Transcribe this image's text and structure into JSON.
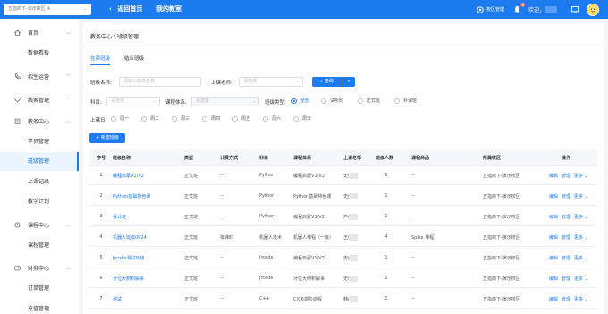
{
  "topbar": {
    "school_select": "五指商下-演示校区 ※",
    "back_label": "返回首页",
    "my_teaching_label": "我的教室",
    "school_manage_label": "校区管理",
    "notify_count": "9",
    "welcome_label": "欢迎，"
  },
  "sidebar": {
    "groups": [
      {
        "label": "首页",
        "icon": "home-icon"
      },
      {
        "label": "招生运营",
        "icon": "phone-icon"
      },
      {
        "label": "线索管理",
        "icon": "heart-icon"
      },
      {
        "label": "教务中心",
        "icon": "building-icon"
      },
      {
        "label": "课程中心",
        "icon": "clock-icon"
      },
      {
        "label": "财务中心",
        "icon": "wallet-icon"
      }
    ],
    "items": {
      "dashboard": "数据看板",
      "students": "学员管理",
      "classes": "班级管理",
      "attendance": "上课记录",
      "plan": "教学计划",
      "courses": "课程管理",
      "orders": "订单管理",
      "recharge": "充值管理"
    }
  },
  "content": {
    "breadcrumb": "教务中心 / 班级管理",
    "tabs": [
      "在读班级",
      "结业班级"
    ],
    "filters": {
      "class_name_label": "班级名称:",
      "class_name_placeholder": "请输入班级名称",
      "teacher_label": "上课老师:",
      "teacher_placeholder": "请选择",
      "query_label": "查询",
      "subject_label": "科目:",
      "subject_placeholder": "请选择",
      "system_label": "课程体系:",
      "system_placeholder": "请选择",
      "class_type_label": "班级类型:",
      "class_type_options": [
        "全部",
        "试听班",
        "正式班",
        "补课班"
      ],
      "weekday_label": "上课日:",
      "weekdays": [
        "周一",
        "周二",
        "周三",
        "周四",
        "周五",
        "周六",
        "周日"
      ]
    },
    "add_label": "+ 新建班级"
  },
  "table": {
    "headers": [
      "序号",
      "班级名称",
      "类型",
      "计费方式",
      "科目",
      "课程体系",
      "上课老师",
      "班级人数",
      "课程商品",
      "所属校区",
      "操作"
    ],
    "rows": [
      {
        "no": "1",
        "name": "编程启蒙V1/V2",
        "type": "正式班",
        "billing": "--",
        "subject": "Python",
        "system": "编程启蒙V1/V2",
        "teacher": "史(",
        "count": "1",
        "product": "--",
        "campus": "五指商下-演示校区"
      },
      {
        "no": "2",
        "name": "Python基础特色课",
        "type": "正式班",
        "billing": "--",
        "subject": "Python",
        "system": "Python基础特色课",
        "teacher": "史(",
        "count": "1",
        "product": "--",
        "campus": "五指商下-演示校区"
      },
      {
        "no": "3",
        "name": "设计班",
        "type": "正式班",
        "billing": "--",
        "subject": "Python",
        "system": "编程启蒙V1/V2",
        "teacher": "芦(",
        "count": "1",
        "product": "--",
        "campus": "五指商下-演示校区"
      },
      {
        "no": "4",
        "name": "机器人班级0524",
        "type": "正式班",
        "billing": "按课时",
        "subject": "机器人技术",
        "system": "机器人课程（一级）",
        "teacher": "王(",
        "count": "4",
        "product": "Spike 课程",
        "campus": "五指商下-演示校区"
      },
      {
        "no": "5",
        "name": "Jrcode测试班级",
        "type": "正式班",
        "billing": "--",
        "subject": "Jrcode",
        "system": "编程启蒙V1/V2",
        "teacher": "史(",
        "count": "1",
        "product": "--",
        "campus": "五指商下-演示校区"
      },
      {
        "no": "6",
        "name": "牙位大俯积解事",
        "type": "正式班",
        "billing": "--",
        "subject": "Jrcode",
        "system": "牙位大俯积解事",
        "teacher": "史(",
        "count": "1",
        "product": "--",
        "campus": "五指商下-演示校区"
      },
      {
        "no": "7",
        "name": "测试",
        "type": "正式班",
        "billing": "--",
        "subject": "C++",
        "system": "C/C6高阶启程",
        "teacher": "韩(",
        "count": "1",
        "product": "--",
        "campus": "五指商下-演示校区"
      }
    ],
    "ops": [
      "编辑",
      "管理",
      "更多 ⌄"
    ]
  },
  "colors": {
    "primary": "#1d7bf0",
    "active_bg": "#ecf4ff",
    "page_bg": "#f3f5f9"
  }
}
